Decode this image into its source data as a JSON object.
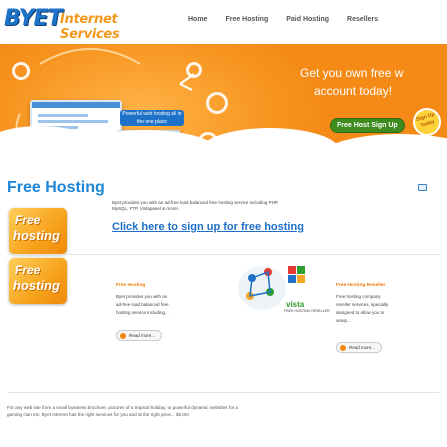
{
  "header": {
    "logo_main": "BYET",
    "logo_sub": "Internet Services",
    "nav": [
      "Home",
      "Free Hosting",
      "Paid Hosting",
      "Resellers"
    ]
  },
  "banner": {
    "line1": "Get you own free w",
    "line2": "account today!",
    "signup_label": "Free Host Sign Up",
    "seal_label": "Sign Up Today",
    "browser_ribbon": "Powerful web hosting all in the one place"
  },
  "main": {
    "title": "Free Hosting",
    "intro_badge": [
      "Free",
      "hosting"
    ],
    "intro_text_1": "Byet provides you with an ad-free load balanced free hosting service including PHP,",
    "intro_text_2": "MySQL, FTP, Vistapanel & more!.",
    "signup_link": "Click here to sign up for free hosting",
    "col_left": {
      "badge": [
        "Free",
        "hosting"
      ],
      "title": "Free Hosting",
      "lines": [
        "Byet provides you with an",
        "ad-free load balanced free",
        "hosting service including..."
      ],
      "read_more": "Read more..."
    },
    "col_center": {
      "label": "vista",
      "sub": "FREE HOSTING RESELLER"
    },
    "col_right": {
      "title": "Free Hosting Reseller",
      "lines": [
        "Free hosting company",
        "reseller services, specially",
        "designed to allow you to",
        "setup..."
      ],
      "read_more": "Read more..."
    },
    "footer_1": "For any web site from a small business brochure, pictures of a tropical holiday, to powerful dynamic websites for a",
    "footer_2": "gaming clan etc, Byet Internet has the right services for you and at the right price... $0.00!"
  },
  "colors": {
    "orange": "#f58a16",
    "blue": "#1e86d6",
    "green": "#3f8c1e"
  }
}
